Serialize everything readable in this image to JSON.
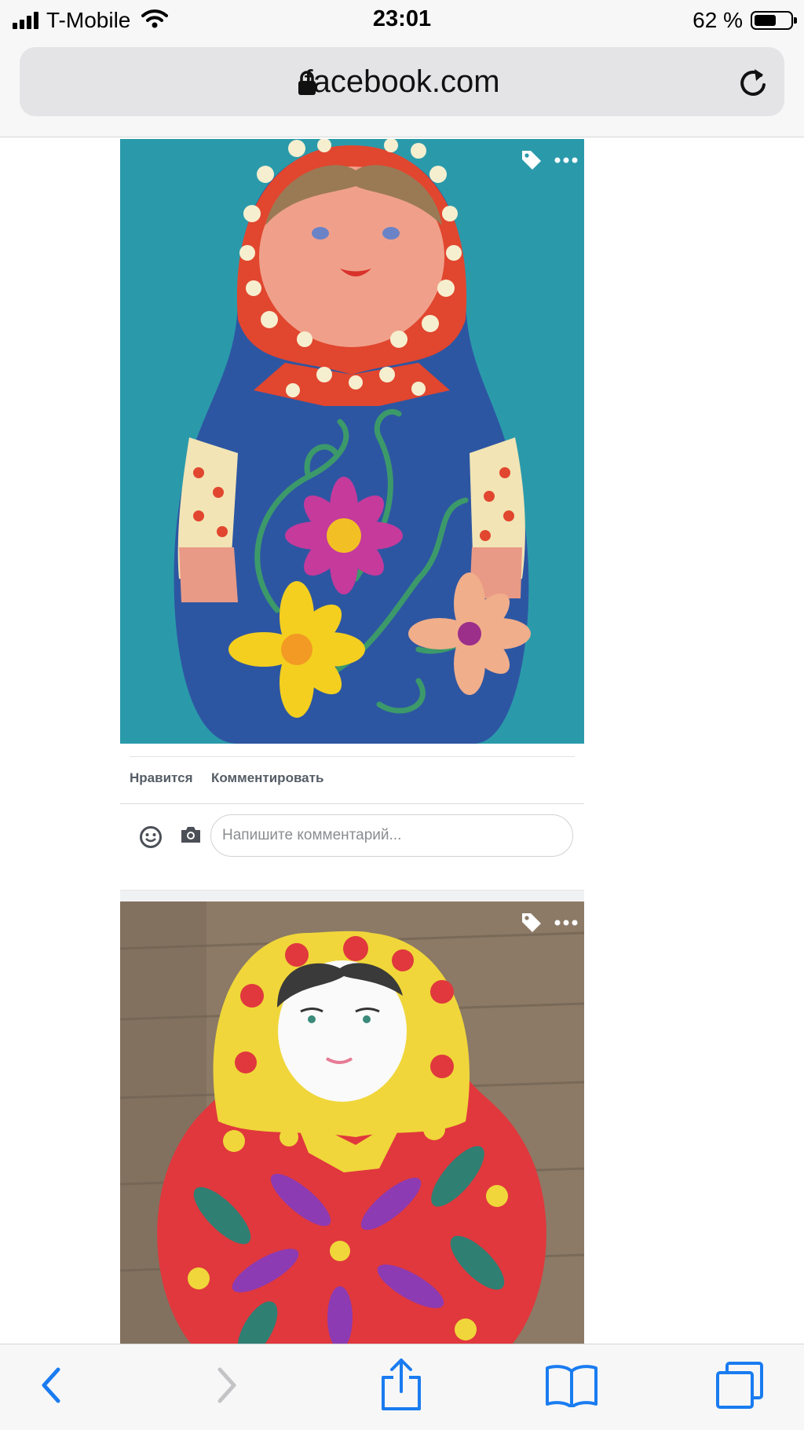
{
  "status_bar": {
    "carrier": "T-Mobile",
    "time": "23:01",
    "battery_percent": "62 %",
    "battery_level": 0.62
  },
  "browser": {
    "url": "facebook.com",
    "icons": [
      "lock-icon",
      "reload-icon"
    ]
  },
  "post1": {
    "photo_icons": [
      "tag-icon",
      "more-icon"
    ],
    "like_label": "Нравится",
    "comment_label": "Комментировать",
    "comment_placeholder": "Напишите комментарий...",
    "comment_icons": [
      "emoji-icon",
      "camera-icon"
    ]
  },
  "post2": {
    "photo_icons": [
      "tag-icon",
      "more-icon"
    ]
  },
  "toolbar": {
    "buttons": [
      "back-arrow-icon",
      "forward-arrow-icon",
      "share-icon",
      "bookmarks-icon",
      "tabs-icon"
    ],
    "forward_enabled": false
  },
  "colors": {
    "ios_blue": "#1a7cf0",
    "chrome_bg": "#f7f7f8",
    "fb_action_text": "#555d66"
  }
}
